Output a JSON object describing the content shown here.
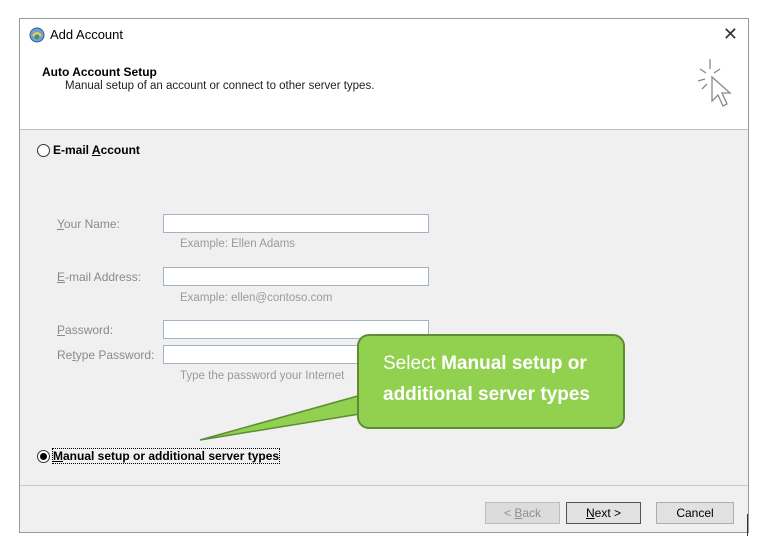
{
  "window": {
    "title": "Add Account",
    "close_glyph": "✕"
  },
  "header": {
    "title": "Auto Account Setup",
    "subtitle": "Manual setup of an account or connect to other server types.",
    "icon": "cursor-sparkle-icon"
  },
  "email_option": {
    "label_pre": "E-mail ",
    "label_accel": "A",
    "label_post": "ccount",
    "selected": false
  },
  "fields": {
    "your_name": {
      "label_pre": "",
      "label_accel": "Y",
      "label_post": "our Name:",
      "value": "",
      "hint": "Example: Ellen Adams"
    },
    "email_address": {
      "label_pre": "",
      "label_accel": "E",
      "label_post": "-mail Address:",
      "value": "",
      "hint": "Example: ellen@contoso.com"
    },
    "password": {
      "label_pre": "",
      "label_accel": "P",
      "label_post": "assword:",
      "value": ""
    },
    "retype_password": {
      "label_pre": "Re",
      "label_accel": "t",
      "label_post": "ype Password:",
      "value": "",
      "hint": "Type the password your Internet"
    }
  },
  "manual_option": {
    "label_pre": "",
    "label_accel": "M",
    "label_post": "anual setup or additional server types",
    "selected": true
  },
  "buttons": {
    "back": {
      "pre": "< ",
      "accel": "B",
      "post": "ack"
    },
    "next": {
      "pre": "",
      "accel": "N",
      "post": "ext >"
    },
    "cancel": "Cancel"
  },
  "callout": {
    "prefix": "Select ",
    "bold": "Manual setup or additional server types"
  },
  "colors": {
    "callout_fill": "#92d050",
    "callout_border": "#5d8c31",
    "input_border": "#a4b2c4"
  }
}
